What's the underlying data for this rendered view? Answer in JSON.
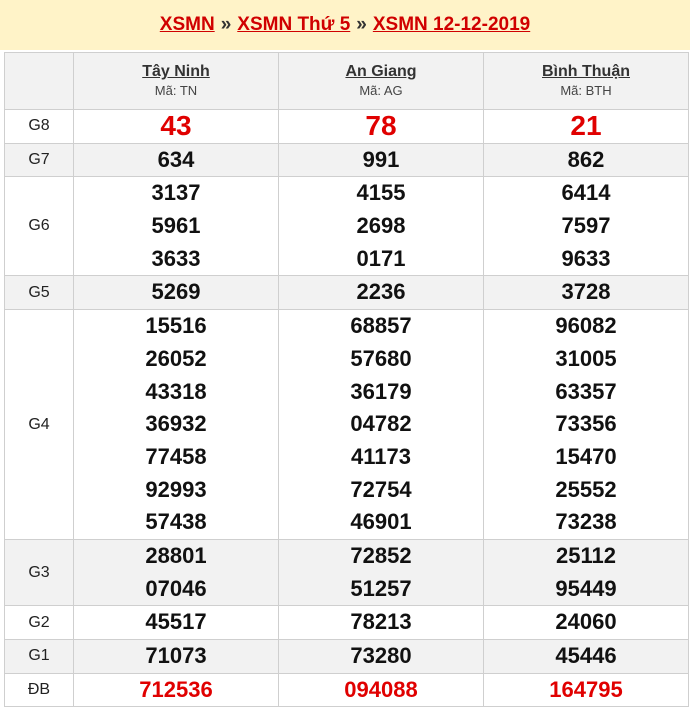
{
  "breadcrumb": {
    "part1": "XSMN",
    "part2": "XSMN Thứ 5",
    "part3": "XSMN 12-12-2019",
    "separator": "»"
  },
  "provinces": [
    {
      "name": "Tây Ninh",
      "code": "Mã: TN"
    },
    {
      "name": "An Giang",
      "code": "Mã: AG"
    },
    {
      "name": "Bình Thuận",
      "code": "Mã: BTH"
    }
  ],
  "prizes": [
    {
      "label": "G8",
      "values": [
        [
          "43"
        ],
        [
          "78"
        ],
        [
          "21"
        ]
      ]
    },
    {
      "label": "G7",
      "values": [
        [
          "634"
        ],
        [
          "991"
        ],
        [
          "862"
        ]
      ]
    },
    {
      "label": "G6",
      "values": [
        [
          "3137",
          "5961",
          "3633"
        ],
        [
          "4155",
          "2698",
          "0171"
        ],
        [
          "6414",
          "7597",
          "9633"
        ]
      ]
    },
    {
      "label": "G5",
      "values": [
        [
          "5269"
        ],
        [
          "2236"
        ],
        [
          "3728"
        ]
      ]
    },
    {
      "label": "G4",
      "values": [
        [
          "15516",
          "26052",
          "43318",
          "36932",
          "77458",
          "92993",
          "57438"
        ],
        [
          "68857",
          "57680",
          "36179",
          "04782",
          "41173",
          "72754",
          "46901"
        ],
        [
          "96082",
          "31005",
          "63357",
          "73356",
          "15470",
          "25552",
          "73238"
        ]
      ]
    },
    {
      "label": "G3",
      "values": [
        [
          "28801",
          "07046"
        ],
        [
          "72852",
          "51257"
        ],
        [
          "25112",
          "95449"
        ]
      ]
    },
    {
      "label": "G2",
      "values": [
        [
          "45517"
        ],
        [
          "78213"
        ],
        [
          "24060"
        ]
      ]
    },
    {
      "label": "G1",
      "values": [
        [
          "71073"
        ],
        [
          "73280"
        ],
        [
          "45446"
        ]
      ]
    },
    {
      "label": "ĐB",
      "values": [
        [
          "712536"
        ],
        [
          "094088"
        ],
        [
          "164795"
        ]
      ]
    }
  ],
  "colors": {
    "accent": "#d00000",
    "header_bg": "#fff3c8",
    "row_shade": "#f2f2f2"
  }
}
